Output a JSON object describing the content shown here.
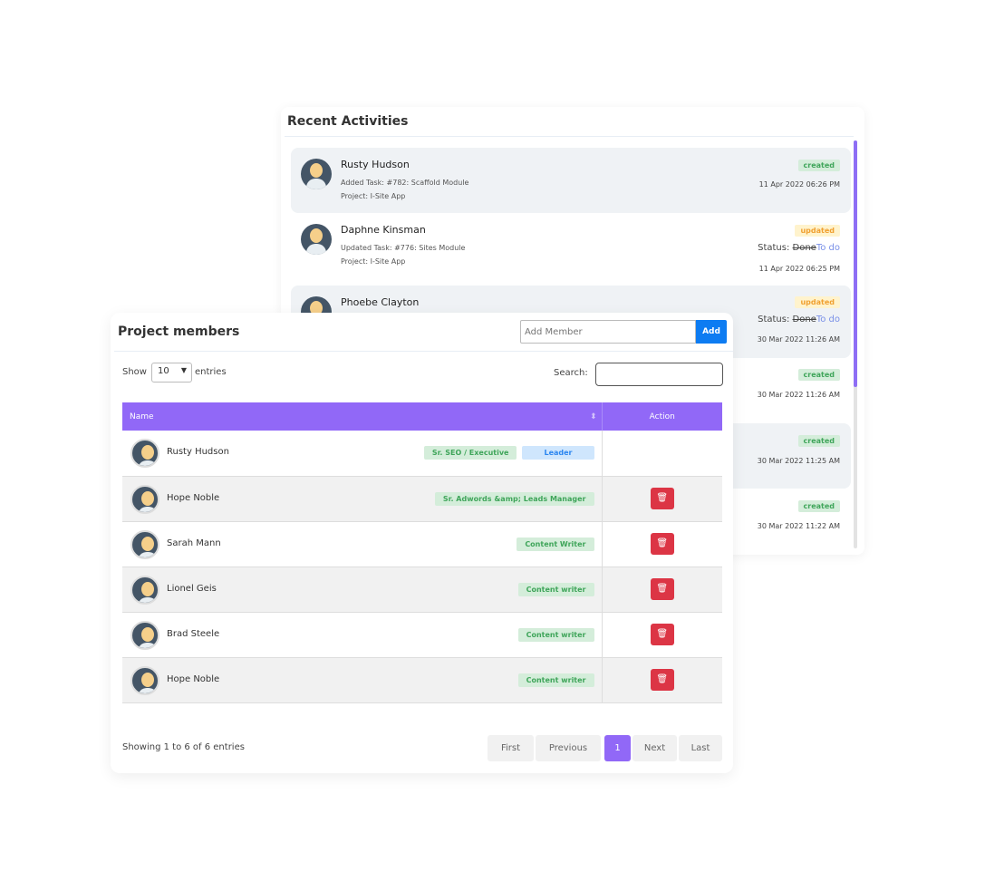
{
  "activities": {
    "title": "Recent Activities",
    "items": [
      {
        "name": "Rusty Hudson",
        "line1": "Added Task: #782: Scaffold Module",
        "line2": "Project: I-Site App",
        "badge": "created",
        "date": "11 Apr 2022 06:26 PM"
      },
      {
        "name": "Daphne Kinsman",
        "line1": "Updated Task: #776: Sites Module",
        "line2": "Project: I-Site App",
        "badge": "updated",
        "status_label": "Status:",
        "status_old": "Done",
        "status_new": "To do",
        "date": "11 Apr 2022 06:25 PM"
      },
      {
        "name": "Phoebe Clayton",
        "badge": "updated",
        "status_label": "Status:",
        "status_old": "Done",
        "status_new": "To do",
        "date": "30 Mar 2022 11:26 AM"
      },
      {
        "badge": "created",
        "date": "30 Mar 2022 11:26 AM"
      },
      {
        "badge": "created",
        "date": "30 Mar 2022 11:25 AM"
      },
      {
        "badge": "created",
        "date": "30 Mar 2022 11:22 AM"
      }
    ]
  },
  "members": {
    "title": "Project members",
    "add_placeholder": "Add Member",
    "add_label": "Add",
    "show": "Show",
    "entries_value": "10",
    "entries": "entries",
    "search_label": "Search:",
    "columns": [
      "Name",
      "Action"
    ],
    "rows": [
      {
        "name": "Rusty Hudson",
        "tags": [
          "Sr. SEO / Executive",
          "Leader"
        ]
      },
      {
        "name": "Hope Noble",
        "tags": [
          "Sr. Adwords &amp; Leads Manager"
        ]
      },
      {
        "name": "Sarah Mann",
        "tags": [
          "Content Writer"
        ]
      },
      {
        "name": "Lionel Geis",
        "tags": [
          "Content writer"
        ]
      },
      {
        "name": "Brad Steele",
        "tags": [
          "Content writer"
        ]
      },
      {
        "name": "Hope Noble",
        "tags": [
          "Content writer"
        ]
      }
    ],
    "info": "Showing 1 to 6 of 6 entries",
    "pagination": [
      "First",
      "Previous",
      "1",
      "Next",
      "Last"
    ]
  }
}
